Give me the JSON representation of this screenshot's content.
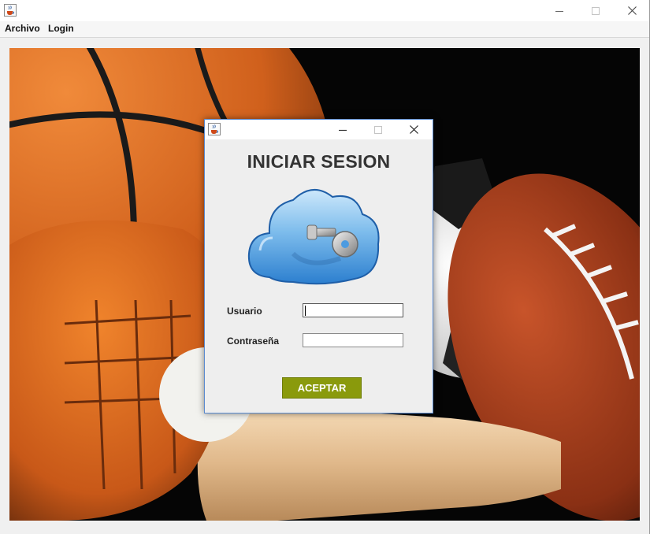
{
  "window": {
    "icon": "java-cup-icon",
    "controls": {
      "minimize": "minimize-icon",
      "maximize": "maximize-icon",
      "close": "close-icon"
    }
  },
  "menu": {
    "items": [
      {
        "label": "Archivo"
      },
      {
        "label": "Login"
      }
    ]
  },
  "dialog": {
    "title": "INICIAR SESION",
    "image": "cloud-key-icon",
    "username_label": "Usuario",
    "username_value": "",
    "password_label": "Contraseña",
    "password_value": "",
    "accept_label": "ACEPTAR",
    "accent_color": "#8a9a0c"
  }
}
